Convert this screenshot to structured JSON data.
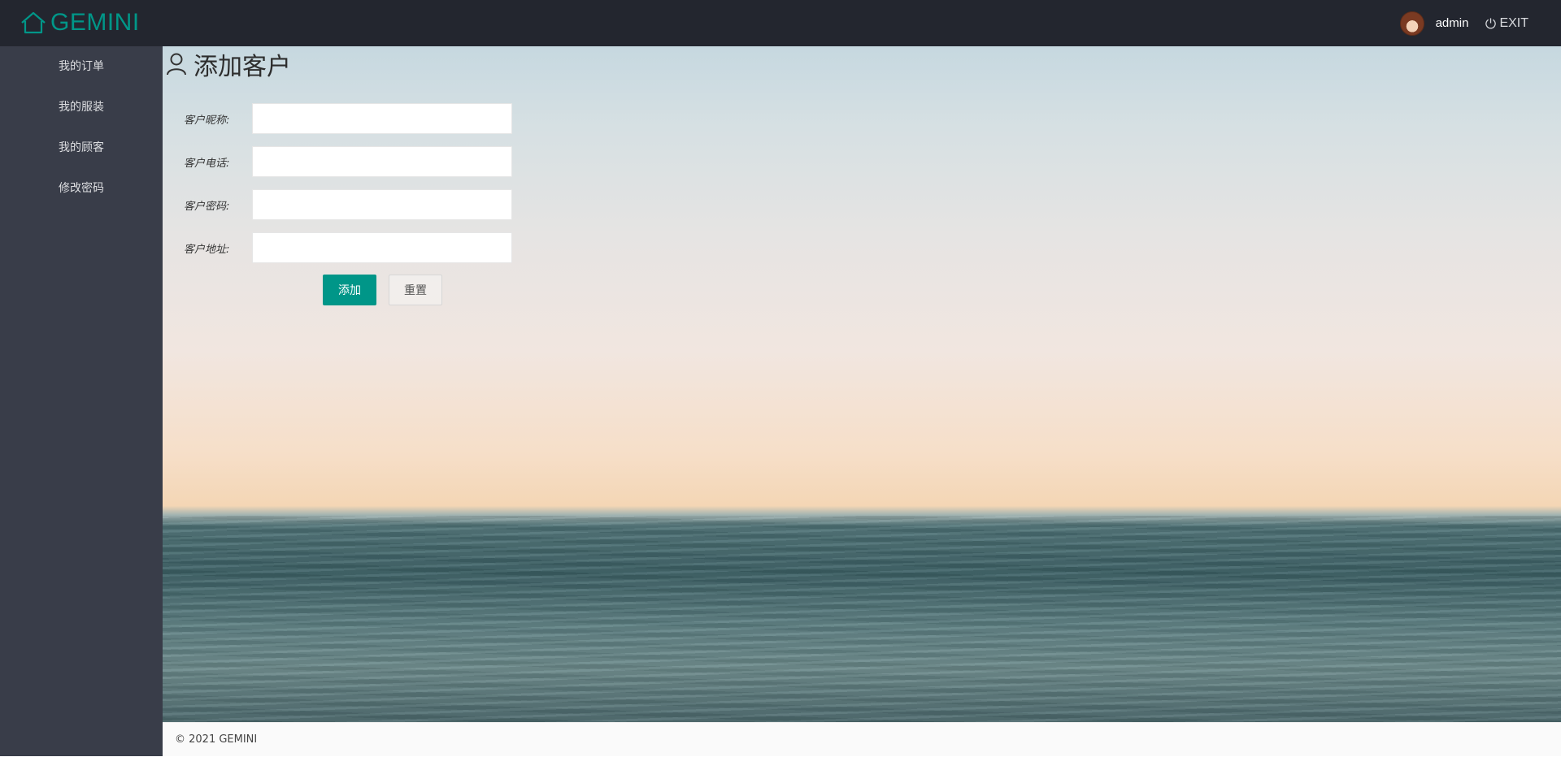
{
  "header": {
    "logo_text": "GEMINI",
    "logo_icon": "home-icon",
    "username": "admin",
    "exit_label": "EXIT",
    "exit_icon": "power-icon",
    "accent_color": "#009688",
    "bar_color": "#23262f"
  },
  "sidebar": {
    "items": [
      {
        "label": "我的订单"
      },
      {
        "label": "我的服装"
      },
      {
        "label": "我的顾客"
      },
      {
        "label": "修改密码"
      }
    ]
  },
  "main": {
    "title": "添加客户",
    "title_icon": "person-icon",
    "form": {
      "fields": [
        {
          "label": "客户昵称:",
          "value": "",
          "placeholder": ""
        },
        {
          "label": "客户电话:",
          "value": "",
          "placeholder": ""
        },
        {
          "label": "客户密码:",
          "value": "",
          "placeholder": ""
        },
        {
          "label": "客户地址:",
          "value": "",
          "placeholder": ""
        }
      ],
      "submit_label": "添加",
      "reset_label": "重置"
    }
  },
  "footer": {
    "text": "© 2021 GEMINI"
  }
}
